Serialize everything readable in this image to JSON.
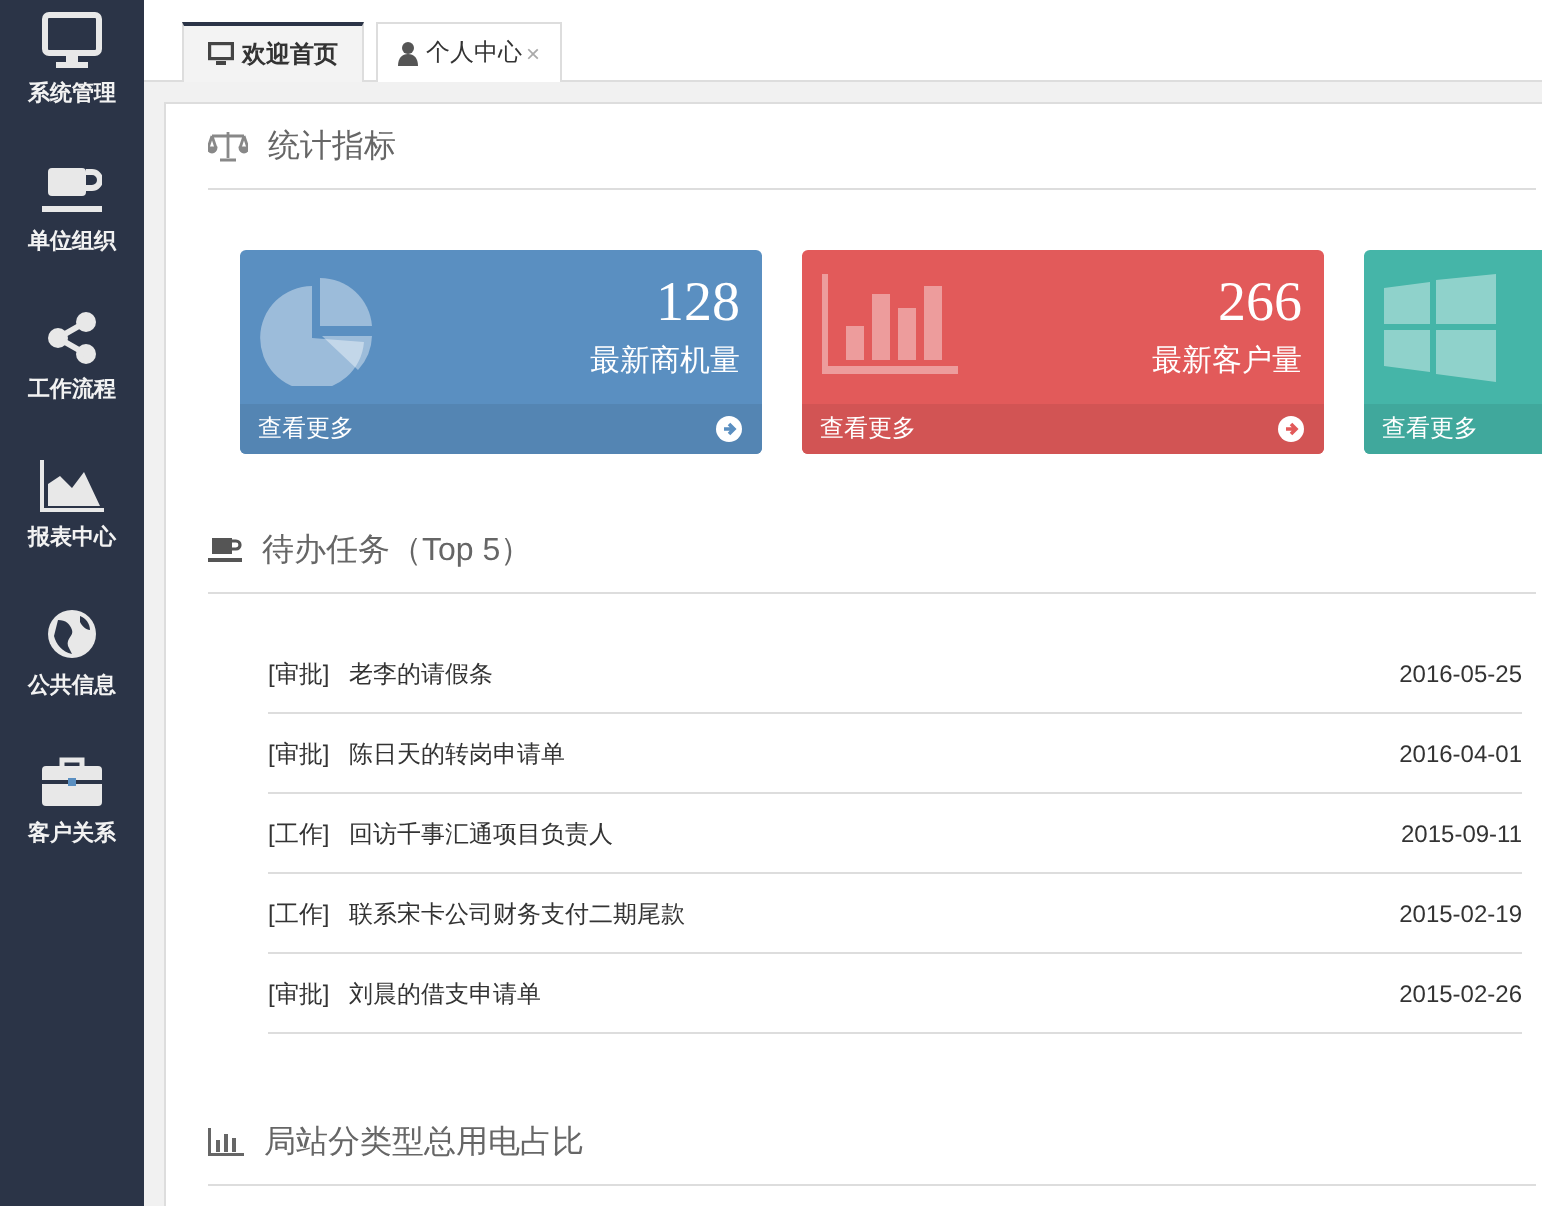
{
  "sidebar": {
    "items": [
      {
        "label": "系统管理"
      },
      {
        "label": "单位组织"
      },
      {
        "label": "工作流程"
      },
      {
        "label": "报表中心"
      },
      {
        "label": "公共信息"
      },
      {
        "label": "客户关系"
      }
    ]
  },
  "tabs": [
    {
      "label": "欢迎首页",
      "selected": true
    },
    {
      "label": "个人中心",
      "selected": false,
      "close": "×"
    }
  ],
  "stats_section": {
    "title": "统计指标"
  },
  "stat_cards": [
    {
      "value": "128",
      "label": "最新商机量",
      "more": "查看更多",
      "arrow": true,
      "color": "#5a8fc1"
    },
    {
      "value": "266",
      "label": "最新客户量",
      "more": "查看更多",
      "arrow": true,
      "color": "#e25a5a"
    },
    {
      "more": "查看更多",
      "color": "#45b5a8"
    }
  ],
  "tasks_section": {
    "title": "待办任务（Top 5）"
  },
  "tasks": [
    {
      "type": "[审批]",
      "title": "老李的请假条",
      "date": "2016-05-25"
    },
    {
      "type": "[审批]",
      "title": "陈日天的转岗申请单",
      "date": "2016-04-01"
    },
    {
      "type": "[工作]",
      "title": "回访千事汇通项目负责人",
      "date": "2015-09-11"
    },
    {
      "type": "[工作]",
      "title": "联系宋卡公司财务支付二期尾款",
      "date": "2015-02-19"
    },
    {
      "type": "[审批]",
      "title": "刘晨的借支申请单",
      "date": "2015-02-26"
    }
  ],
  "power_section": {
    "title": "局站分类型总用电占比"
  }
}
